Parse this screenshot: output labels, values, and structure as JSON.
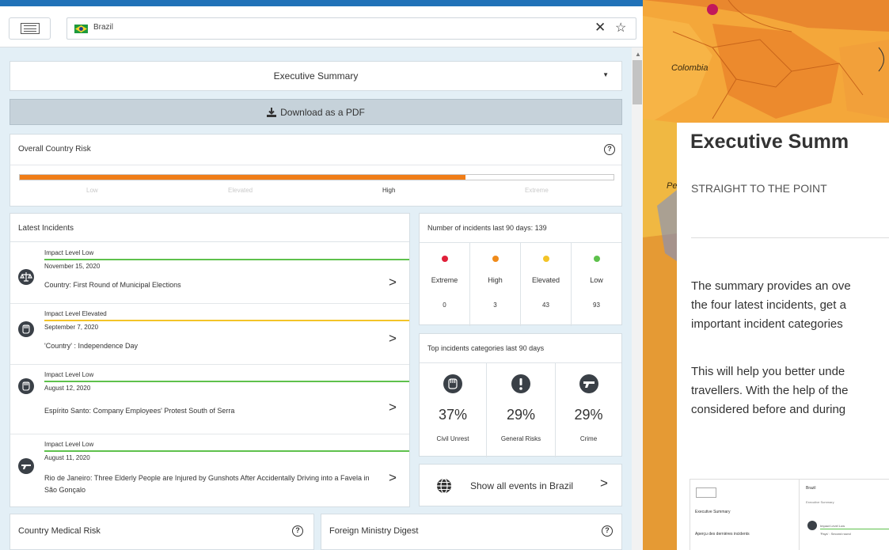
{
  "header": {
    "search_value": "Brazil"
  },
  "summary_select": {
    "label": "Executive Summary"
  },
  "pdf_button": {
    "label": "Download as a PDF"
  },
  "country_risk": {
    "title": "Overall Country Risk",
    "help": "?",
    "levels": [
      "Low",
      "Elevated",
      "High",
      "Extreme"
    ],
    "current_level": "High",
    "progress_fraction": 0.75,
    "fill_color": "#f07d17"
  },
  "latest_incidents": {
    "title": "Latest Incidents",
    "items": [
      {
        "impact": "Impact Level Low",
        "impact_color": "#5ec14c",
        "date": "November 15, 2020",
        "title": "Country: First Round of Municipal Elections",
        "icon": "scales-icon"
      },
      {
        "impact": "Impact Level Elevated",
        "impact_color": "#f3c428",
        "date": "September 7, 2020",
        "title": "'Country' : Independence Day",
        "icon": "fist-icon"
      },
      {
        "impact": "Impact Level Low",
        "impact_color": "#5ec14c",
        "date": "August 12, 2020",
        "title": "Espírito Santo: Company Employees' Protest South of Serra",
        "icon": "fist-icon"
      },
      {
        "impact": "Impact Level Low",
        "impact_color": "#5ec14c",
        "date": "August 11, 2020",
        "title": "Rio de Janeiro: Three Elderly People are Injured by Gunshots After Accidentally Driving into a Favela in São Gonçalo",
        "icon": "gun-icon"
      }
    ]
  },
  "incident_counts": {
    "title": "Number of incidents last 90 days: 139",
    "levels": [
      {
        "label": "Extreme",
        "value": "0",
        "color": "#e0203a"
      },
      {
        "label": "High",
        "value": "3",
        "color": "#f08b1a"
      },
      {
        "label": "Elevated",
        "value": "43",
        "color": "#f3c428"
      },
      {
        "label": "Low",
        "value": "93",
        "color": "#5ec14c"
      }
    ]
  },
  "top_categories": {
    "title": "Top incidents categories last 90 days",
    "items": [
      {
        "pct": "37%",
        "label": "Civil Unrest",
        "icon": "fist-icon"
      },
      {
        "pct": "29%",
        "label": "General Risks",
        "icon": "exclamation-icon"
      },
      {
        "pct": "29%",
        "label": "Crime",
        "icon": "gun-icon"
      }
    ]
  },
  "show_all": {
    "label": "Show all events in Brazil"
  },
  "medical_risk": {
    "title": "Country Medical Risk",
    "help": "?"
  },
  "foreign_digest": {
    "title": "Foreign Ministry Digest",
    "help": "?"
  },
  "map": {
    "labels": [
      "Colombia",
      "Pe"
    ]
  },
  "overlay": {
    "title": "Executive Summ",
    "subtitle": "STRAIGHT TO THE POINT",
    "para1": [
      "The summary provides an ove",
      "the four latest incidents, get a",
      "important incident categories"
    ],
    "para2": [
      "This will help you better unde",
      "travellers. With the help of the",
      "considered before and during"
    ],
    "thumb": {
      "left_1": "Executive Summary",
      "left_2": "Aperçu des dernières incidents",
      "right_1": "Brazil",
      "right_2": "Executive Summary",
      "right_3": "Impact Level Low",
      "right_4": "'Pays' : Second round"
    }
  }
}
